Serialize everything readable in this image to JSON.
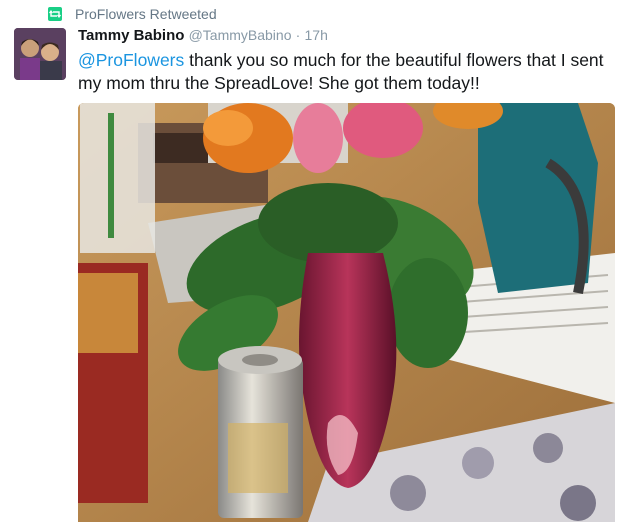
{
  "retweet": {
    "label": "ProFlowers Retweeted",
    "icon": "retweet-icon",
    "color": "#19cf86"
  },
  "author": {
    "name": "Tammy Babino",
    "handle": "@TammyBabino",
    "separator": "·",
    "time": "17h"
  },
  "tweet": {
    "mention": "@ProFlowers",
    "text": " thank you so much for the beautiful flowers that I sent my mom thru the SpreadLove! She got them today!!"
  },
  "colors": {
    "mention": "#1b95e0",
    "secondary": "#657786",
    "primary": "#14171a"
  }
}
